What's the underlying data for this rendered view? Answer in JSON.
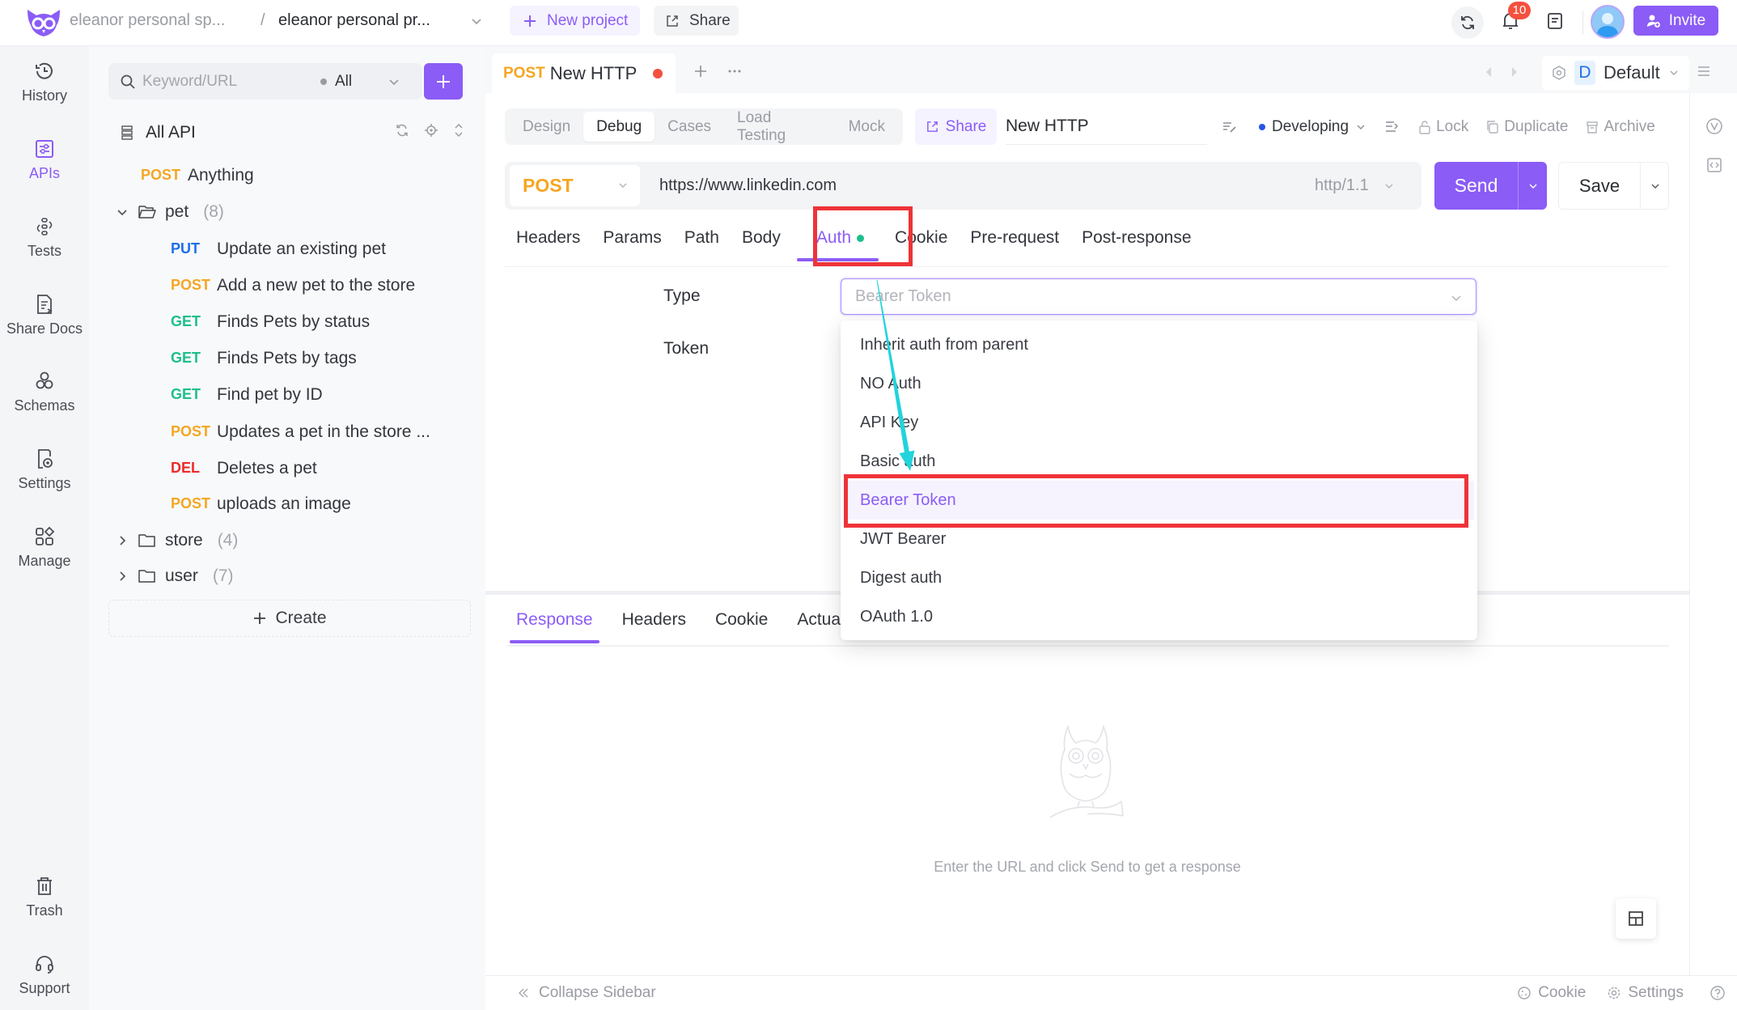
{
  "topbar": {
    "workspace": "eleanor personal sp...",
    "separator": "/",
    "project": "eleanor personal pr...",
    "new_project_label": "New project",
    "share_label": "Share",
    "notification_count": "10",
    "invite_label": "Invite"
  },
  "nav": {
    "items": [
      {
        "label": "History",
        "icon": "history-icon"
      },
      {
        "label": "APIs",
        "icon": "apis-icon",
        "active": true
      },
      {
        "label": "Tests",
        "icon": "tests-icon"
      },
      {
        "label": "Share Docs",
        "icon": "share-docs-icon"
      },
      {
        "label": "Schemas",
        "icon": "schemas-icon"
      },
      {
        "label": "Settings",
        "icon": "settings-icon"
      },
      {
        "label": "Manage",
        "icon": "manage-icon"
      }
    ],
    "bottom_items": [
      {
        "label": "Trash",
        "icon": "trash-icon"
      },
      {
        "label": "Support",
        "icon": "headset-icon"
      }
    ]
  },
  "tree": {
    "search_placeholder": "Keyword/URL",
    "filter_value": "All",
    "root_label": "All API",
    "top_items": [
      {
        "method": "POST",
        "name": "Anything"
      }
    ],
    "folders": [
      {
        "name": "pet",
        "count": "(8)",
        "expanded": true,
        "items": [
          {
            "method": "PUT",
            "name": "Update an existing pet"
          },
          {
            "method": "POST",
            "name": "Add a new pet to the store"
          },
          {
            "method": "GET",
            "name": "Finds Pets by status"
          },
          {
            "method": "GET",
            "name": "Finds Pets by tags"
          },
          {
            "method": "GET",
            "name": "Find pet by ID"
          },
          {
            "method": "POST",
            "name": "Updates a pet in the store ..."
          },
          {
            "method": "DEL",
            "name": "Deletes a pet"
          },
          {
            "method": "POST",
            "name": "uploads an image"
          }
        ]
      },
      {
        "name": "store",
        "count": "(4)",
        "expanded": false
      },
      {
        "name": "user",
        "count": "(7)",
        "expanded": false
      }
    ],
    "create_label": "Create"
  },
  "tabs": {
    "open": [
      {
        "method": "POST",
        "title": "New HTTP",
        "unsaved": true
      }
    ],
    "env": {
      "badge": "D",
      "name": "Default"
    }
  },
  "modes": {
    "items": [
      "Design",
      "Debug",
      "Cases",
      "Load Testing",
      "Mock"
    ],
    "active": "Debug",
    "share_label": "Share",
    "name_value": "New HTTP",
    "status": "Developing",
    "actions": [
      "Lock",
      "Duplicate",
      "Archive"
    ]
  },
  "request": {
    "method": "POST",
    "url": "https://www.linkedin.com",
    "protocol": "http/1.1",
    "send_label": "Send",
    "save_label": "Save",
    "tabs": [
      "Headers",
      "Params",
      "Path",
      "Body",
      "Auth",
      "Cookie",
      "Pre-request",
      "Post-response"
    ],
    "active_tab": "Auth"
  },
  "auth": {
    "type_label": "Type",
    "token_label": "Token",
    "selected": "Bearer Token",
    "options": [
      "Inherit auth from parent",
      "NO Auth",
      "API Key",
      "Basic auth",
      "Bearer Token",
      "JWT Bearer",
      "Digest auth",
      "OAuth 1.0"
    ]
  },
  "response": {
    "tabs": [
      "Response",
      "Headers",
      "Cookie",
      "Actual Request"
    ],
    "active_tab": "Response",
    "empty_message": "Enter the URL and click Send to get a response"
  },
  "footer": {
    "collapse_label": "Collapse Sidebar",
    "cookie_label": "Cookie",
    "settings_label": "Settings"
  },
  "colors": {
    "accent": "#8b5cf6",
    "method_post": "#f5a623",
    "method_get": "#1dbf8b",
    "method_put": "#1e6fe8",
    "method_delete": "#ee2a2a",
    "annotation_box": "#ee3338",
    "annotation_arrow": "#22d3dc",
    "notification_badge": "#f5503f"
  }
}
